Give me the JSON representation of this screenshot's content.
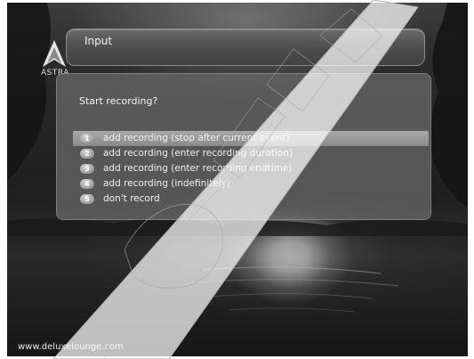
{
  "brand": {
    "logo_text": "ASTRA"
  },
  "window": {
    "title": "Input"
  },
  "dialog": {
    "question": "Start recording?",
    "options": [
      {
        "number": "1",
        "label": "add recording (stop after current event)",
        "selected": true
      },
      {
        "number": "2",
        "label": "add recording (enter recording duration)",
        "selected": false
      },
      {
        "number": "3",
        "label": "add recording (enter recording endtime)",
        "selected": false
      },
      {
        "number": "4",
        "label": "add recording (indefinitely)",
        "selected": false
      },
      {
        "number": "5",
        "label": "don't record",
        "selected": false
      }
    ]
  },
  "footer": {
    "url": "www.deluxelounge.com"
  },
  "colors": {
    "selection": "#9a9a9a",
    "panel": "#6c6c6c",
    "watermark": "#ffffff"
  }
}
